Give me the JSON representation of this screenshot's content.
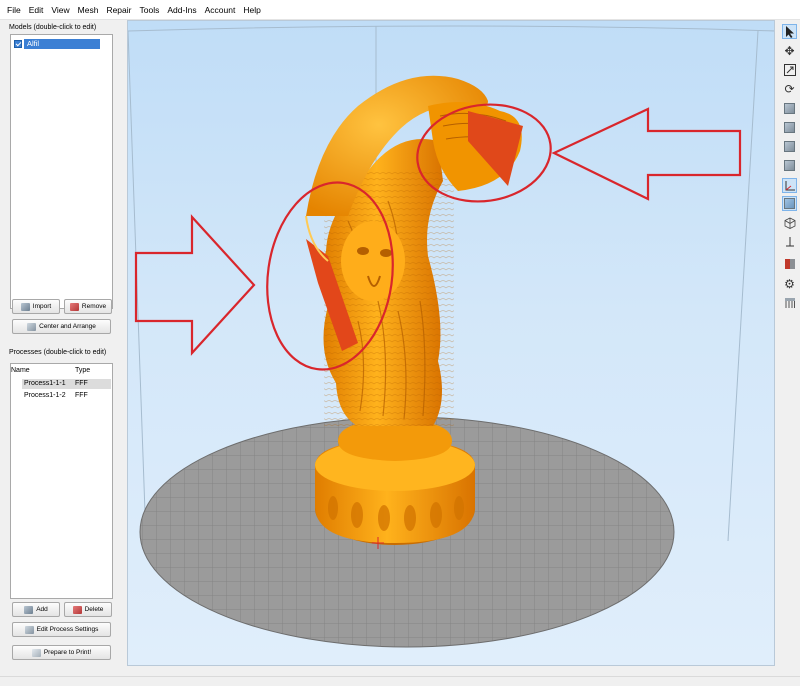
{
  "menu": [
    "File",
    "Edit",
    "View",
    "Mesh",
    "Repair",
    "Tools",
    "Add-Ins",
    "Account",
    "Help"
  ],
  "models": {
    "label": "Models (double-click to edit)",
    "items": [
      "Alfil"
    ],
    "import_label": "Import",
    "remove_label": "Remove",
    "center_label": "Center and Arrange"
  },
  "processes": {
    "label": "Processes (double-click to edit)",
    "columns": [
      "Name",
      "Type"
    ],
    "rows": [
      {
        "name": "Process1-1-1",
        "type": "FFF",
        "selected": true
      },
      {
        "name": "Process1-1-2",
        "type": "FFF",
        "selected": false
      }
    ],
    "add_label": "Add",
    "delete_label": "Delete",
    "edit_label": "Edit Process Settings",
    "prepare_label": "Prepare to Print!"
  },
  "viewport": {
    "model_color": "#f9a50c",
    "bed_color": "#9a9a9a",
    "annotation_color": "#d9262c"
  },
  "toolbar_icons": [
    "select-pointer-icon",
    "move-icon",
    "scale-icon",
    "rotate-icon",
    "view-cube-icon",
    "view-cube-icon",
    "view-cube-icon",
    "view-cube-icon",
    "axis-icon",
    "view-cube-icon",
    "wireframe-icon",
    "perpendicular-icon",
    "section-view-icon",
    "settings-gear-icon",
    "support-icon"
  ]
}
